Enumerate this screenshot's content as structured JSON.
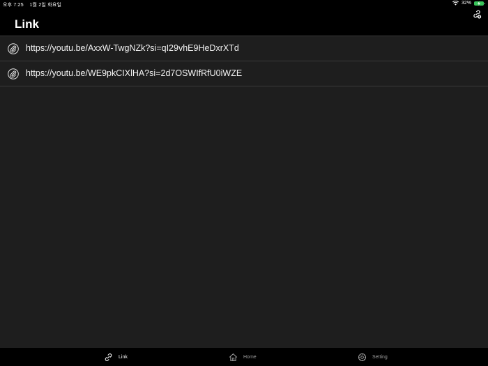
{
  "status_bar": {
    "time": "오후 7:25",
    "date": "1월 2일 화요일",
    "battery_percent": "32%"
  },
  "header": {
    "title": "Link"
  },
  "links": [
    {
      "url": "https://youtu.be/AxxW-TwgNZk?si=qI29vhE9HeDxrXTd"
    },
    {
      "url": "https://youtu.be/WE9pkCIXlHA?si=2d7OSWIfRfU0iWZE"
    }
  ],
  "tabs": [
    {
      "label": "Link",
      "active": true,
      "icon": "link-icon"
    },
    {
      "label": "Home",
      "active": false,
      "icon": "home-icon"
    },
    {
      "label": "Setting",
      "active": false,
      "icon": "gear-icon"
    }
  ],
  "colors": {
    "background": "#1e1e1e",
    "bar": "#000000",
    "divider": "#3a3a3a",
    "battery": "#39c45a"
  }
}
